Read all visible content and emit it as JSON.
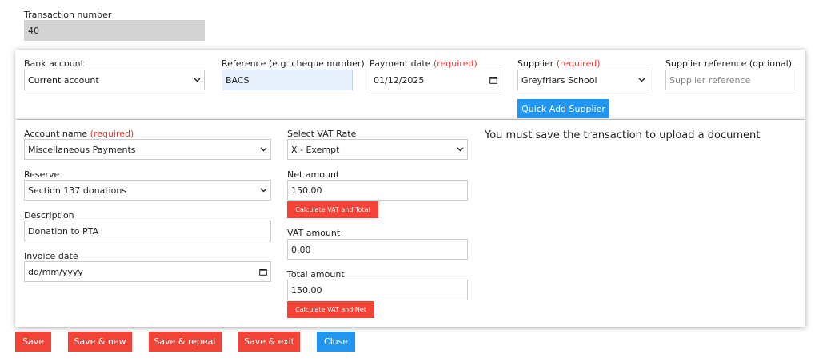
{
  "transaction": {
    "label": "Transaction number",
    "value": "40"
  },
  "header": {
    "bank_account": {
      "label": "Bank account",
      "value": "Current account"
    },
    "reference": {
      "label": "Reference (e.g. cheque number)",
      "value": "BACS"
    },
    "payment_date": {
      "label": "Payment date",
      "required": "(required)",
      "value": "01/12/2025"
    },
    "supplier": {
      "label": "Supplier",
      "required": "(required)",
      "value": "Greyfriars School"
    },
    "supplier_reference": {
      "label": "Supplier reference (optional)",
      "placeholder": "Supplier reference",
      "value": ""
    },
    "quick_add_label": "Quick Add Supplier"
  },
  "line": {
    "account_name": {
      "label": "Account name",
      "required": "(required)",
      "value": "Miscellaneous Payments"
    },
    "reserve": {
      "label": "Reserve",
      "value": "Section 137 donations"
    },
    "description": {
      "label": "Description",
      "value": "Donation to PTA"
    },
    "invoice_date": {
      "label": "Invoice date",
      "placeholder": "dd/mm/yyyy"
    },
    "vat_rate": {
      "label": "Select VAT Rate",
      "value": "X - Exempt"
    },
    "net_amount": {
      "label": "Net amount",
      "value": "150.00"
    },
    "calc_vat_total_label": "Calculate VAT and Total",
    "vat_amount": {
      "label": "VAT amount",
      "value": "0.00"
    },
    "total_amount": {
      "label": "Total amount",
      "value": "150.00"
    },
    "calc_vat_net_label": "Calculate VAT and Net",
    "upload_message": "You must save the transaction to upload a document"
  },
  "actions": {
    "save": "Save",
    "save_new": "Save & new",
    "save_repeat": "Save & repeat",
    "save_exit": "Save & exit",
    "close": "Close"
  },
  "colors": {
    "primary": "#2196f3",
    "danger": "#f44336",
    "required": "#e53935"
  }
}
